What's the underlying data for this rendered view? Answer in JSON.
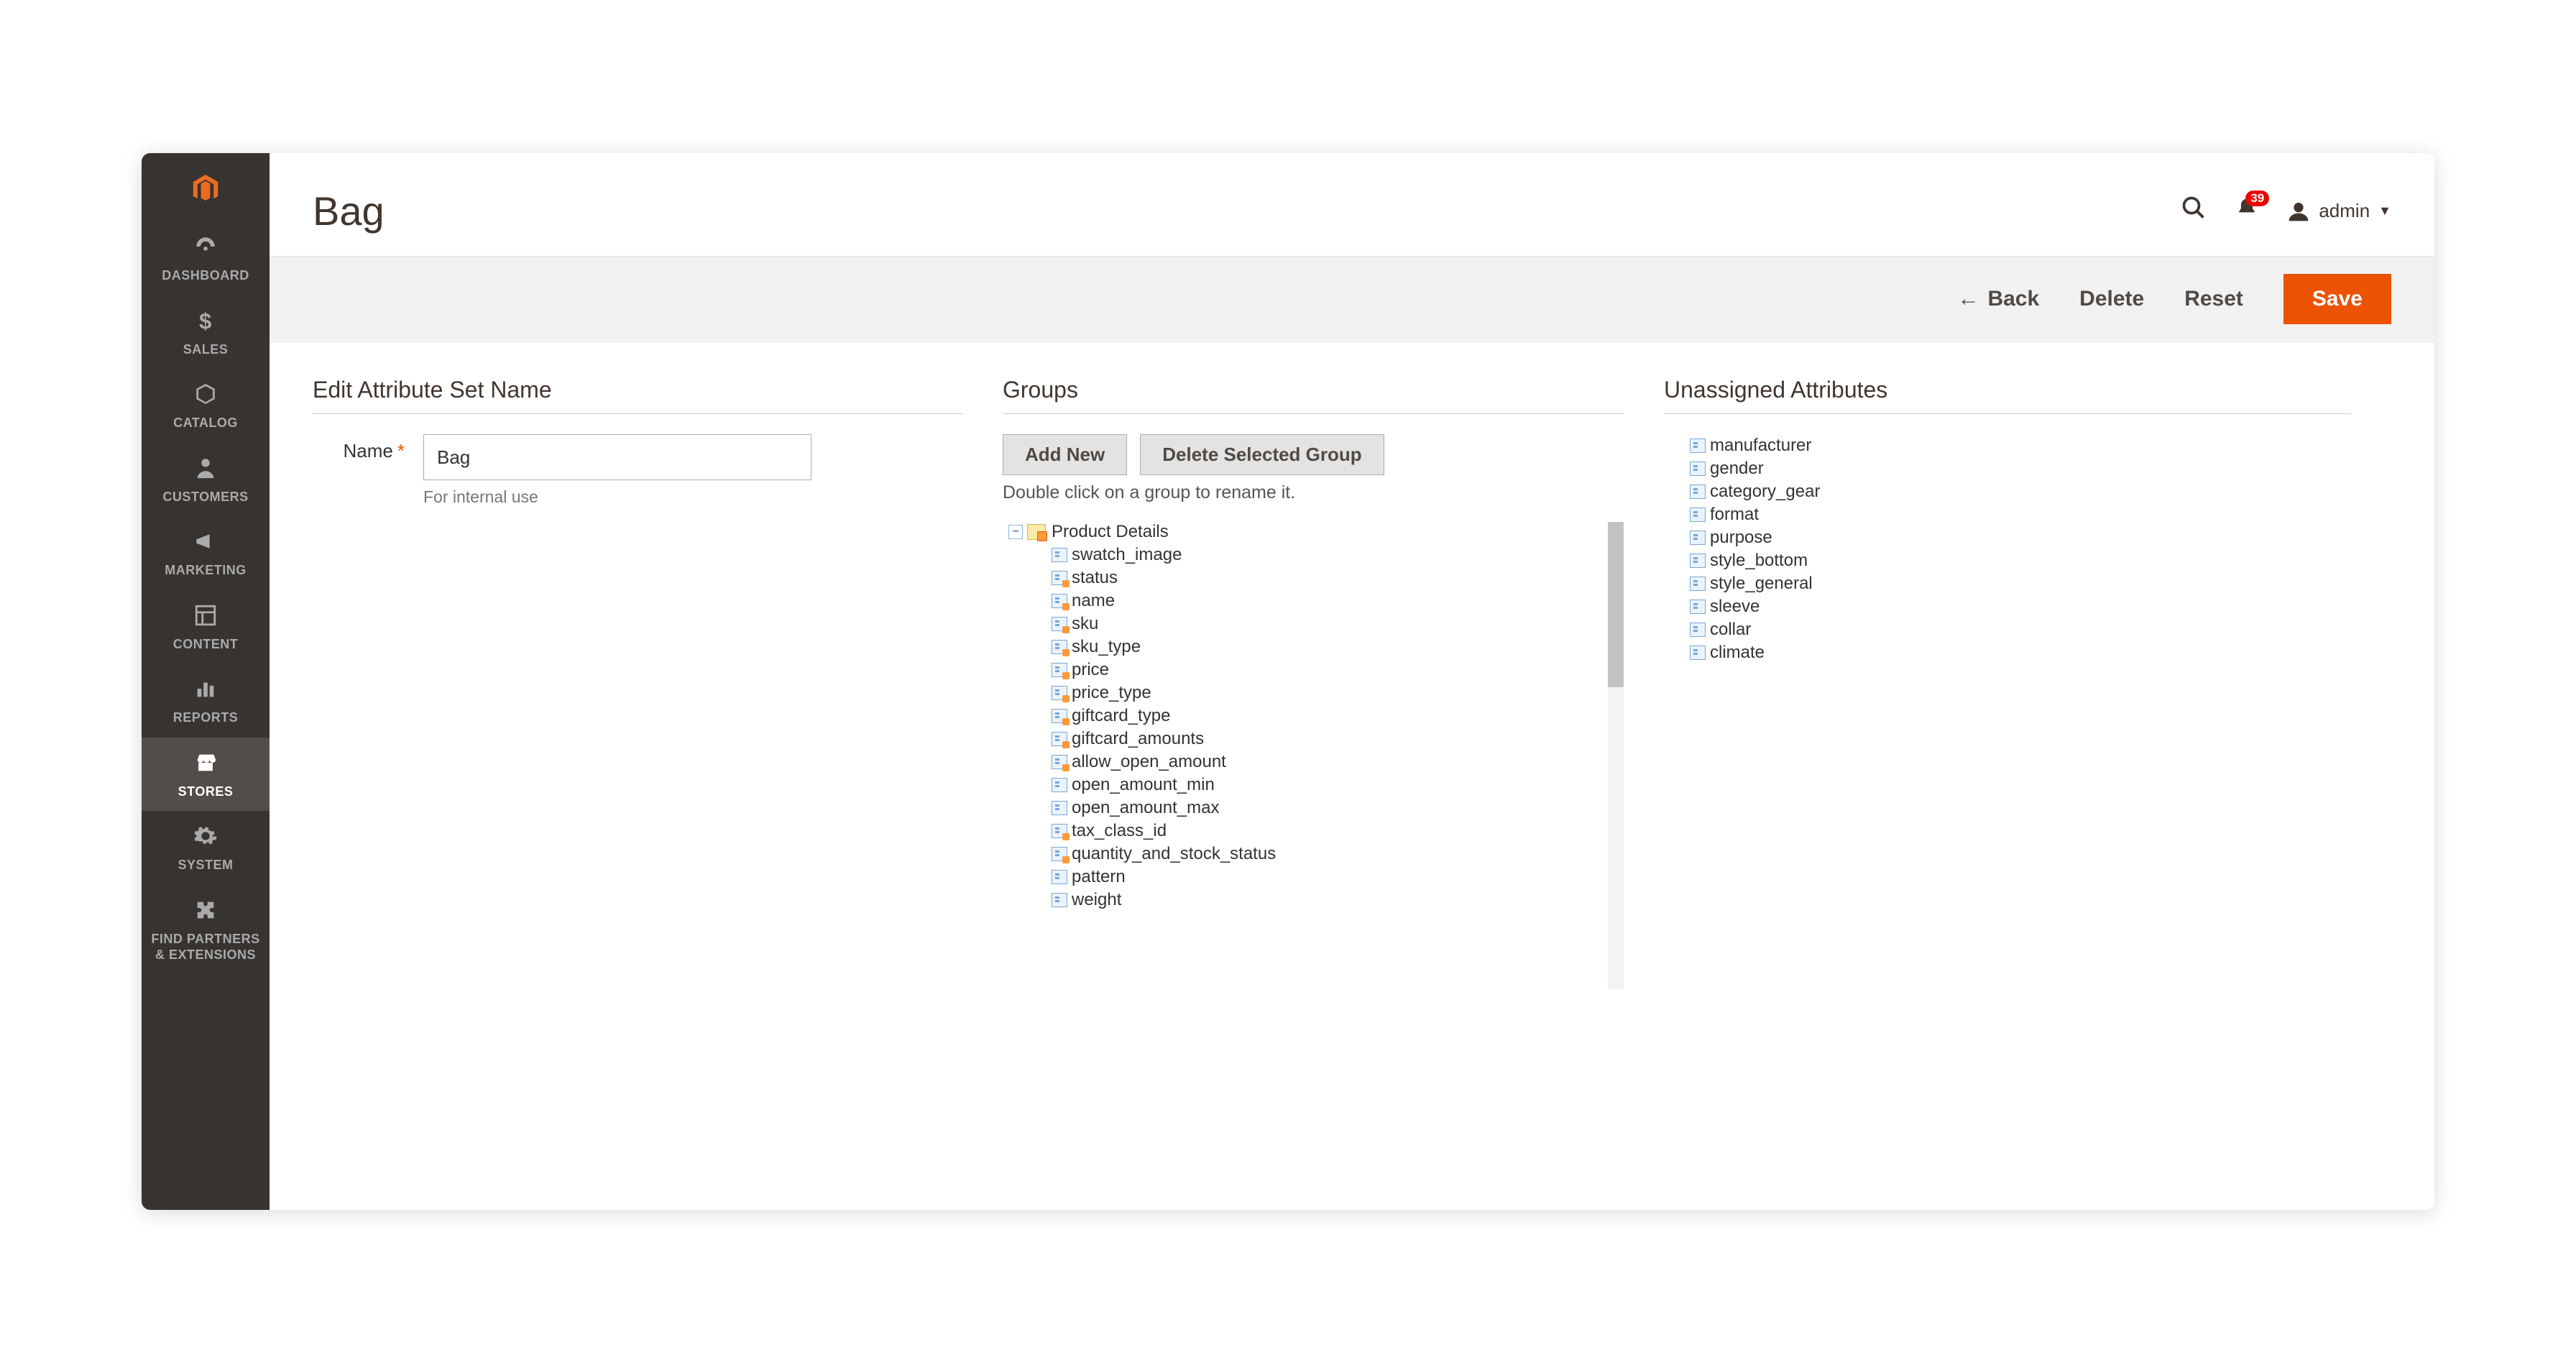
{
  "sidebar": {
    "items": [
      {
        "label": "DASHBOARD",
        "icon": "dashboard"
      },
      {
        "label": "SALES",
        "icon": "dollar"
      },
      {
        "label": "CATALOG",
        "icon": "box"
      },
      {
        "label": "CUSTOMERS",
        "icon": "person"
      },
      {
        "label": "MARKETING",
        "icon": "megaphone"
      },
      {
        "label": "CONTENT",
        "icon": "layout"
      },
      {
        "label": "REPORTS",
        "icon": "bars"
      },
      {
        "label": "STORES",
        "icon": "store",
        "active": true
      },
      {
        "label": "SYSTEM",
        "icon": "gear"
      },
      {
        "label": "FIND PARTNERS\n& EXTENSIONS",
        "icon": "puzzle"
      }
    ]
  },
  "header": {
    "title": "Bag",
    "notification_count": "39",
    "user_name": "admin"
  },
  "actionbar": {
    "back": "Back",
    "delete": "Delete",
    "reset": "Reset",
    "save": "Save"
  },
  "col1": {
    "heading": "Edit Attribute Set Name",
    "name_label": "Name",
    "name_value": "Bag",
    "name_hint": "For internal use"
  },
  "col2": {
    "heading": "Groups",
    "add_new": "Add New",
    "delete_group": "Delete Selected Group",
    "hint": "Double click on a group to rename it.",
    "root": "Product Details",
    "attributes": [
      {
        "name": "swatch_image",
        "locked": false
      },
      {
        "name": "status",
        "locked": true
      },
      {
        "name": "name",
        "locked": true
      },
      {
        "name": "sku",
        "locked": true
      },
      {
        "name": "sku_type",
        "locked": true
      },
      {
        "name": "price",
        "locked": true
      },
      {
        "name": "price_type",
        "locked": true
      },
      {
        "name": "giftcard_type",
        "locked": true
      },
      {
        "name": "giftcard_amounts",
        "locked": true
      },
      {
        "name": "allow_open_amount",
        "locked": true
      },
      {
        "name": "open_amount_min",
        "locked": false
      },
      {
        "name": "open_amount_max",
        "locked": false
      },
      {
        "name": "tax_class_id",
        "locked": true
      },
      {
        "name": "quantity_and_stock_status",
        "locked": true
      },
      {
        "name": "pattern",
        "locked": false
      },
      {
        "name": "weight",
        "locked": false
      }
    ]
  },
  "col3": {
    "heading": "Unassigned Attributes",
    "attributes": [
      "manufacturer",
      "gender",
      "category_gear",
      "format",
      "purpose",
      "style_bottom",
      "style_general",
      "sleeve",
      "collar",
      "climate"
    ]
  }
}
